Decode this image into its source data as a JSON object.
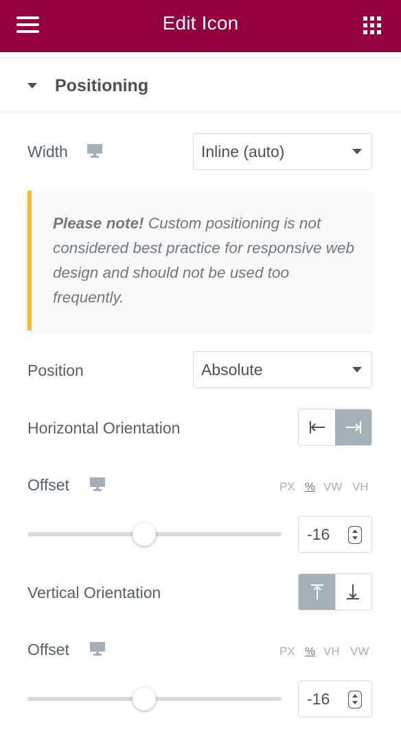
{
  "header": {
    "title": "Edit Icon",
    "background_color": "#93003c",
    "menu_icon": "hamburger-icon",
    "apps_icon": "grid-icon"
  },
  "section": {
    "label": "Positioning",
    "expanded": true
  },
  "width_control": {
    "label": "Width",
    "device_icon": "desktop-icon",
    "selected": "Inline (auto)"
  },
  "note": {
    "bold": "Please note!",
    "text": " Custom positioning is not considered best practice for responsive web design and should not be used too frequently.",
    "accent_color": "#fcb92c"
  },
  "position_control": {
    "label": "Position",
    "selected": "Absolute"
  },
  "horizontal_orientation": {
    "label": "Horizontal Orientation",
    "options": [
      "align-left-icon",
      "align-right-icon"
    ],
    "active_index": 1
  },
  "horizontal_offset": {
    "label": "Offset",
    "device_icon": "desktop-icon",
    "units": [
      "PX",
      "%",
      "VW",
      "VH"
    ],
    "active_unit": "%",
    "value": "-16"
  },
  "vertical_orientation": {
    "label": "Vertical Orientation",
    "options": [
      "align-top-icon",
      "align-bottom-icon"
    ],
    "active_index": 0
  },
  "vertical_offset": {
    "label": "Offset",
    "device_icon": "desktop-icon",
    "units": [
      "PX",
      "%",
      "VH",
      "VW"
    ],
    "active_unit": "%",
    "value": "-16"
  },
  "colors": {
    "active_toggle": "#a4afb7",
    "text": "#556068"
  }
}
